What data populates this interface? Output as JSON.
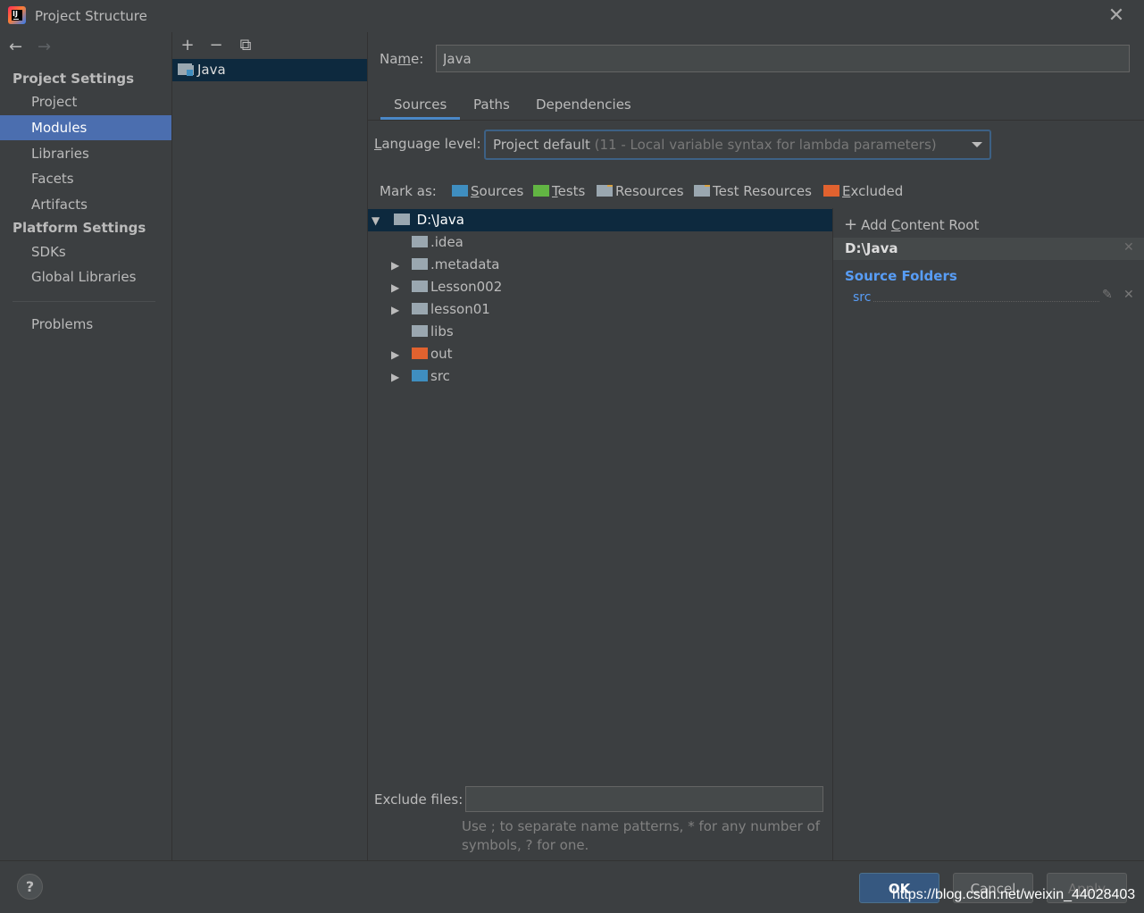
{
  "window": {
    "title": "Project Structure",
    "close": "✕"
  },
  "nav": {
    "back": "←",
    "forward": "→"
  },
  "sidebar": {
    "project_settings_header": "Project Settings",
    "project_settings_items": [
      {
        "label": "Project"
      },
      {
        "label": "Modules",
        "selected": true
      },
      {
        "label": "Libraries"
      },
      {
        "label": "Facets"
      },
      {
        "label": "Artifacts"
      }
    ],
    "platform_settings_header": "Platform Settings",
    "platform_settings_items": [
      {
        "label": "SDKs"
      },
      {
        "label": "Global Libraries"
      }
    ],
    "problems": "Problems"
  },
  "module_toolbar": {
    "add": "+",
    "remove": "−",
    "copy": "⧉"
  },
  "modules": [
    {
      "name": "Java"
    }
  ],
  "name_field": {
    "label_pre": "Na",
    "label_mn": "m",
    "label_post": "e:",
    "value": "Java"
  },
  "tabs": [
    {
      "label": "Sources",
      "active": true
    },
    {
      "label": "Paths"
    },
    {
      "label": "Dependencies"
    }
  ],
  "language_level": {
    "label_mn": "L",
    "label_rest": "anguage level:",
    "selected_main": "Project default",
    "selected_detail": "(11 - Local variable syntax for lambda parameters)"
  },
  "mark_as": {
    "label": "Mark as:",
    "sources_mn": "S",
    "sources_rest": "ources",
    "tests_mn": "T",
    "tests_rest": "ests",
    "resources": "Resources",
    "test_resources": "Test Resources",
    "excluded_mn": "E",
    "excluded_rest": "xcluded"
  },
  "tree": {
    "root": "D:\\Java",
    "children": [
      {
        "name": ".idea",
        "expandable": false,
        "color": "grey"
      },
      {
        "name": ".metadata",
        "expandable": true,
        "color": "grey"
      },
      {
        "name": "Lesson002",
        "expandable": true,
        "color": "grey"
      },
      {
        "name": "lesson01",
        "expandable": true,
        "color": "grey"
      },
      {
        "name": "libs",
        "expandable": false,
        "color": "grey"
      },
      {
        "name": "out",
        "expandable": true,
        "color": "orange"
      },
      {
        "name": "src",
        "expandable": true,
        "color": "blue"
      }
    ]
  },
  "exclude": {
    "label": "Exclude files:",
    "value": "",
    "hint_line1": "Use ; to separate name patterns, * for any number of",
    "hint_line2": "symbols, ? for one."
  },
  "content_root": {
    "add_plus": "+",
    "add_pre": "Add ",
    "add_mn": "C",
    "add_rest": "ontent Root",
    "title": "D:\\Java",
    "source_folders_title": "Source Folders",
    "source_folders": [
      "src"
    ]
  },
  "buttons": {
    "help": "?",
    "ok": "OK",
    "cancel": "Cancel",
    "apply": "Apply"
  },
  "watermark": "https://blog.csdn.net/weixin_44028403",
  "colors": {
    "accent": "#4b6eaf",
    "selection": "#0d293e",
    "link": "#589df6",
    "excluded": "#e1622f",
    "source": "#3f8ec0",
    "test": "#62b543"
  }
}
